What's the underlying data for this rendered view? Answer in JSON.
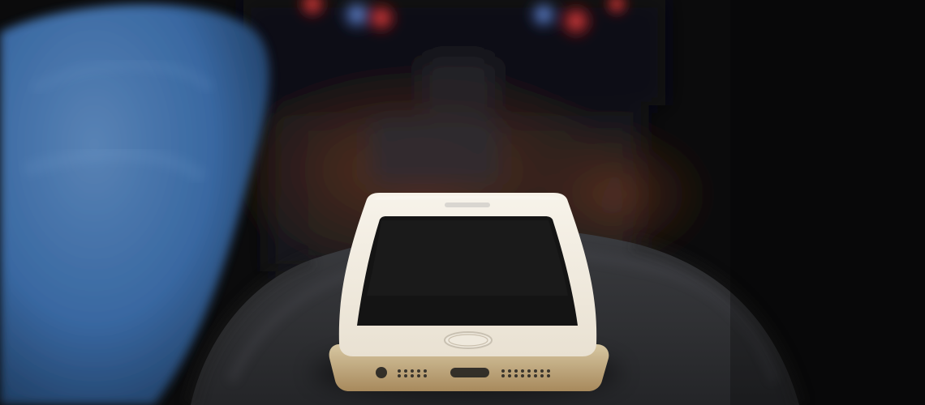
{
  "scene": {
    "subject": "smartphone",
    "phone_color": "gold-white",
    "colors": {
      "background": "#0b0b0c",
      "armrest": "#2f3033",
      "denim": "#2f5f98",
      "phone_body": "#f3efe6",
      "phone_edge": "#cbb890",
      "screen": "#141414",
      "wood": "#5a2c1c"
    }
  }
}
